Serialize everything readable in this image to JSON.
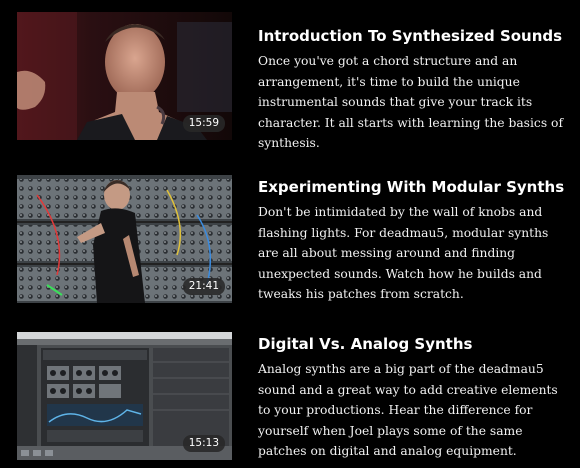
{
  "lessons": [
    {
      "title": "Introduction To Synthesized Sounds",
      "description": "Once you've got a chord structure and an arrangement, it's time to build the unique instrumental sounds that give your track its character. It all starts with learning the basics of synthesis.",
      "duration": "15:59"
    },
    {
      "title": "Experimenting With Modular Synths",
      "description": "Don't be intimidated by the wall of knobs and flashing lights. For deadmau5, modular synths are all about messing around and finding unexpected sounds. Watch how he builds and tweaks his patches from scratch.",
      "duration": "21:41"
    },
    {
      "title": "Digital Vs. Analog Synths",
      "description": "Analog synths are a big part of the deadmau5 sound and a great way to add creative elements to your productions. Hear the difference for yourself when Joel plays some of the same patches on digital and analog equipment.",
      "duration": "15:13"
    }
  ]
}
